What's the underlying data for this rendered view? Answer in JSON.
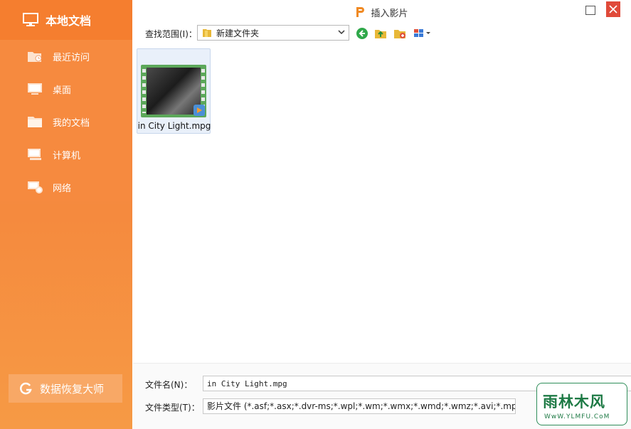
{
  "window": {
    "title": "插入影片"
  },
  "sidebar": {
    "header": "本地文档",
    "items": [
      {
        "label": "最近访问",
        "icon": "recent-folder-icon"
      },
      {
        "label": "桌面",
        "icon": "desktop-icon"
      },
      {
        "label": "我的文档",
        "icon": "folder-icon"
      },
      {
        "label": "计算机",
        "icon": "computer-icon"
      },
      {
        "label": "网络",
        "icon": "network-icon"
      }
    ],
    "recover_button": "数据恢复大师"
  },
  "toolbar": {
    "look_in_label": "查找范围(I)：",
    "current_folder": "新建文件夹",
    "icons": [
      "back-icon",
      "up-folder-icon",
      "new-folder-icon",
      "view-menu-icon"
    ]
  },
  "files": [
    {
      "name": "in City Light.mpg",
      "type": "video",
      "selected": true
    }
  ],
  "fields": {
    "filename_label": "文件名(N)：",
    "filename_value": "in City Light.mpg",
    "filetype_label": "文件类型(T)：",
    "filetype_value": "影片文件 (*.asf;*.asx;*.dvr-ms;*.wpl;*.wm;*.wmx;*.wmd;*.wmz;*.avi;*.mpeg;*.mpg"
  },
  "watermark": {
    "main": "雨林木风",
    "sub": "WwW.YLMFU.CoM"
  },
  "colors": {
    "sidebar": "#f68a3f",
    "sidebar_header": "#f57e2f",
    "close": "#e04a3a",
    "watermark": "#1e7a45"
  }
}
